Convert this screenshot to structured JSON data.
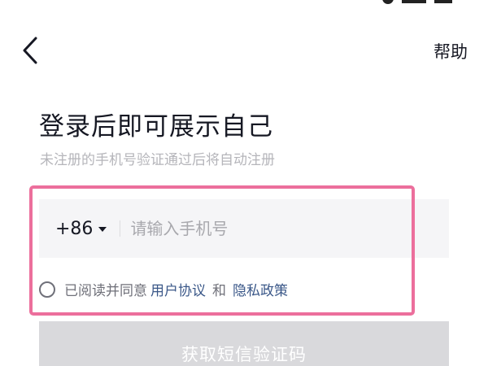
{
  "header": {
    "help_label": "帮助"
  },
  "login": {
    "title": "登录后即可展示自己",
    "subtitle": "未注册的手机号验证通过后将自动注册",
    "country_code": "+86",
    "phone_placeholder": "请输入手机号",
    "agreement": {
      "prefix": "已阅读并同意",
      "user_agreement": "用户协议",
      "conjunction": "和",
      "privacy_policy": "隐私政策"
    },
    "sms_button_label": "获取短信验证码"
  },
  "colors": {
    "highlight": "#ec6f9c",
    "link": "#3a5788",
    "button_disabled": "#d9d9dc"
  }
}
